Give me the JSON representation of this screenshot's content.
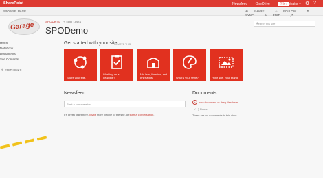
{
  "suitebar": {
    "brand": "SharePoint",
    "links": [
      "Newsfeed",
      "OneDrive",
      "Sites"
    ],
    "user": "administrator ▾",
    "gear_icon": "gear-icon",
    "help_icon": "help-icon"
  },
  "ribbon": {
    "tabs": [
      "BROWSE",
      "PAGE"
    ],
    "actions": [
      "SHARE",
      "FOLLOW",
      "SYNC",
      "EDIT"
    ]
  },
  "header": {
    "logo_text": "Garage",
    "crumb": "SPODemo",
    "edit_links": "EDIT LINKS",
    "title": "SPODemo",
    "search_placeholder": "Search this site"
  },
  "quicklaunch": {
    "items": [
      "Home",
      "Notebook",
      "Documents",
      "Site Contents"
    ],
    "edit_links": "EDIT LINKS"
  },
  "getting_started": {
    "heading": "Get started with your site",
    "remove": "REMOVE THIS",
    "tiles": [
      {
        "label": "Share your site.",
        "icon": "share-icon"
      },
      {
        "label": "Working on a deadline?",
        "icon": "clipboard-check-icon"
      },
      {
        "label": "Add lists, libraries, and other apps.",
        "icon": "apps-icon"
      },
      {
        "label": "What's your style?",
        "icon": "palette-icon"
      },
      {
        "label": "Your site. Your brand.",
        "icon": "brand-image-icon"
      }
    ]
  },
  "newsfeed": {
    "title": "Newsfeed",
    "placeholder": "Start a conversation",
    "note_pre": "It's pretty quiet here. ",
    "invite": "Invite",
    "note_mid": " more people to the site, or ",
    "start_conv": "start a conversation",
    "note_end": "."
  },
  "documents": {
    "title": "Documents",
    "new_doc": "new document or drag files here",
    "col_name": "Name",
    "empty": "There are no documents in this view."
  },
  "colors": {
    "suitebar": "#dd3a31",
    "tile": "#e1311f",
    "link": "#c9423a"
  }
}
